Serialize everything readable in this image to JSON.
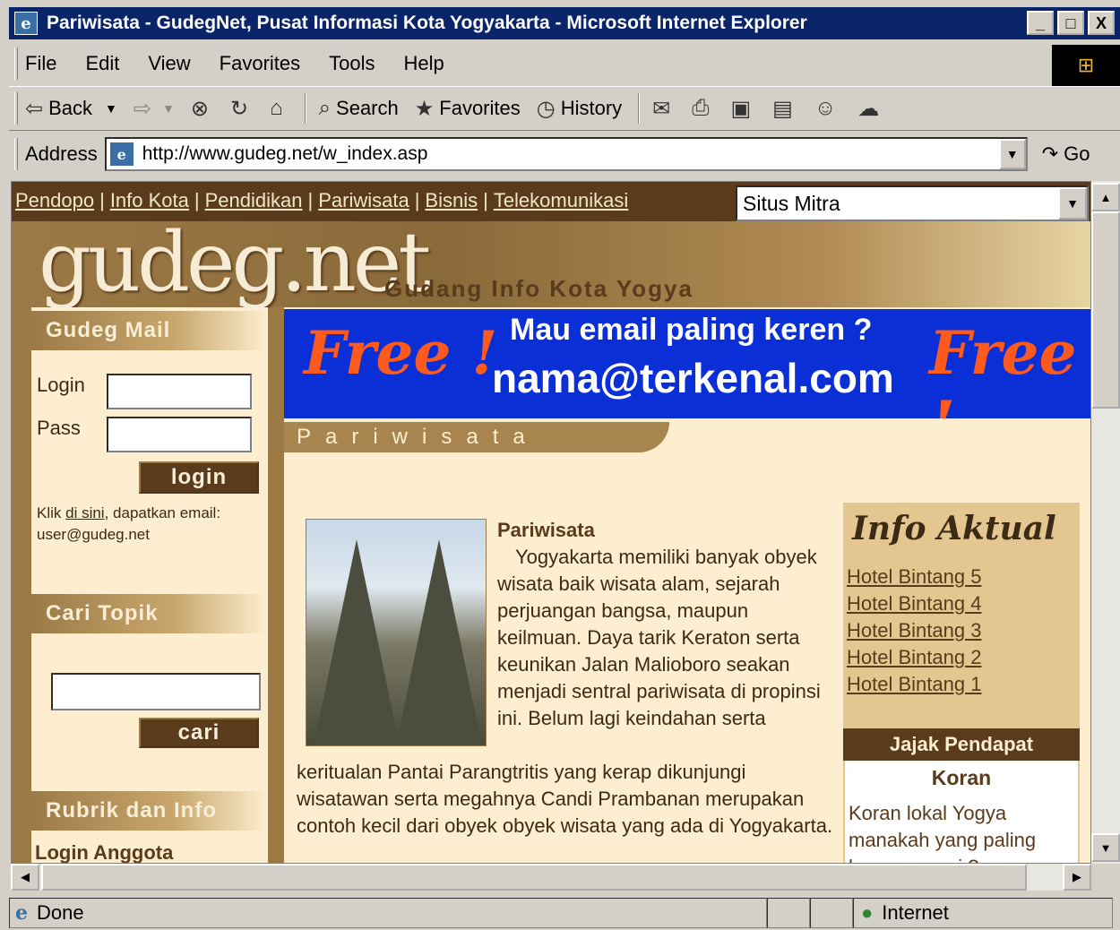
{
  "window": {
    "title": "Pariwisata - GudegNet, Pusat Informasi Kota Yogyakarta - Microsoft Internet Explorer",
    "minimize": "_",
    "maximize": "□",
    "close": "X"
  },
  "menu": [
    "File",
    "Edit",
    "View",
    "Favorites",
    "Tools",
    "Help"
  ],
  "toolbar": {
    "back": "Back",
    "search": "Search",
    "favorites": "Favorites",
    "history": "History"
  },
  "address": {
    "label": "Address",
    "url": "http://www.gudeg.net/w_index.asp",
    "go": "Go"
  },
  "topnav": {
    "links": [
      "Pendopo",
      "Info Kota",
      "Pendidikan",
      "Pariwisata",
      "Bisnis",
      "Telekomunikasi"
    ],
    "separator": "|",
    "mitra": "Situs Mitra"
  },
  "header": {
    "logo": "gudeg.net",
    "tagline": "Gudang Info Kota Yogya"
  },
  "mail": {
    "title": "Gudeg Mail",
    "login_label": "Login",
    "pass_label": "Pass",
    "login_button": "login",
    "note_prefix": "Klik ",
    "note_link": "di sini",
    "note_suffix": ", dapatkan email:",
    "note_email": "user@gudeg.net"
  },
  "search": {
    "title": "Cari Topik",
    "button": "cari"
  },
  "rubrik": {
    "title": "Rubrik dan Info",
    "first": "Login Anggota"
  },
  "banner": {
    "free": "Free !",
    "question": "Mau email paling keren ?",
    "email": "nama@terkenal.com"
  },
  "section_tab": "Pariwisata",
  "article": {
    "title": "Pariwisata",
    "para1": "Yogyakarta memiliki banyak obyek wisata baik wisata alam, sejarah perjuangan bangsa, maupun keilmuan. Daya tarik Keraton serta keunikan Jalan Malioboro seakan menjadi sentral pariwisata di propinsi ini. Belum lagi keindahan serta",
    "para2": "keritualan Pantai Parangtritis yang kerap dikunjungi wisatawan serta megahnya Candi Prambanan merupakan contoh kecil dari obyek obyek wisata yang ada di Yogyakarta."
  },
  "info_aktual": {
    "title": "Info Aktual",
    "links": [
      "Hotel Bintang 5",
      "Hotel Bintang 4",
      "Hotel Bintang 3",
      "Hotel Bintang 2",
      "Hotel Bintang 1"
    ]
  },
  "poll": {
    "title": "Jajak Pendapat",
    "subtitle": "Koran",
    "question": "Koran lokal Yogya manakah yang paling kamu gemari ?"
  },
  "status": {
    "text": "Done",
    "zone": "Internet"
  },
  "colors": {
    "brown_dark": "#5a3b1b",
    "brown": "#9c7a46",
    "cream": "#fdeecf",
    "banner_blue": "#0a2fd6",
    "banner_orange": "#ff5a1e"
  }
}
